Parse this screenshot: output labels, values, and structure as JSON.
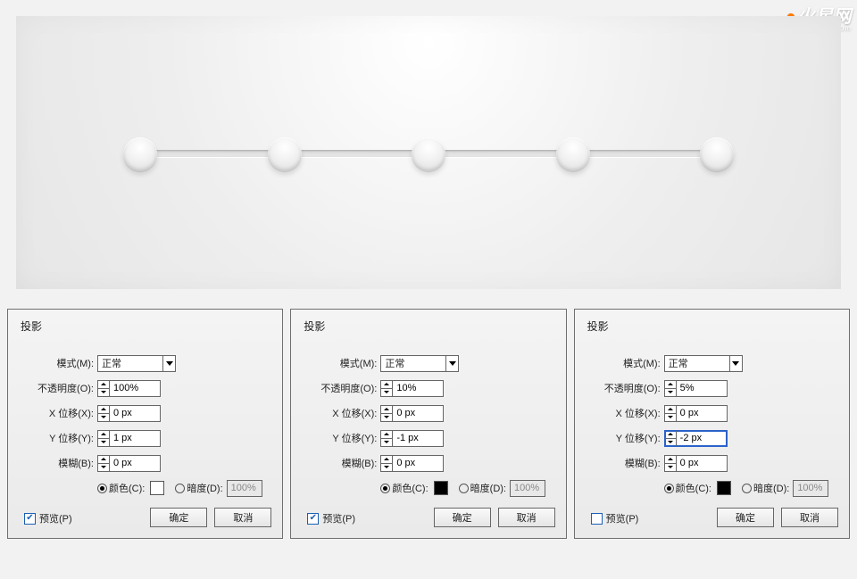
{
  "watermark": {
    "main": "火星网",
    "o": "⬤",
    "sub": "hxsd.com"
  },
  "labels": {
    "title": "投影",
    "mode": "模式(M):",
    "opacity": "不透明度(O):",
    "xoff": "X 位移(X):",
    "yoff": "Y 位移(Y):",
    "blur": "模糊(B):",
    "color": "颜色(C):",
    "dark": "暗度(D):",
    "preview": "预览(P)",
    "ok": "确定",
    "cancel": "取消"
  },
  "panels": [
    {
      "mode": "正常",
      "opacity": "100%",
      "x": "0 px",
      "y": "1 px",
      "blur": "0 px",
      "colorSwatch": "#ffffff",
      "dark": "100%",
      "previewChecked": true
    },
    {
      "mode": "正常",
      "opacity": "10%",
      "x": "0 px",
      "y": "-1 px",
      "blur": "0 px",
      "colorSwatch": "#000000",
      "dark": "100%",
      "previewChecked": true
    },
    {
      "mode": "正常",
      "opacity": "5%",
      "x": "0 px",
      "y": "-2 px",
      "blur": "0 px",
      "colorSwatch": "#000000",
      "dark": "100%",
      "previewChecked": false,
      "yFocused": true
    }
  ]
}
